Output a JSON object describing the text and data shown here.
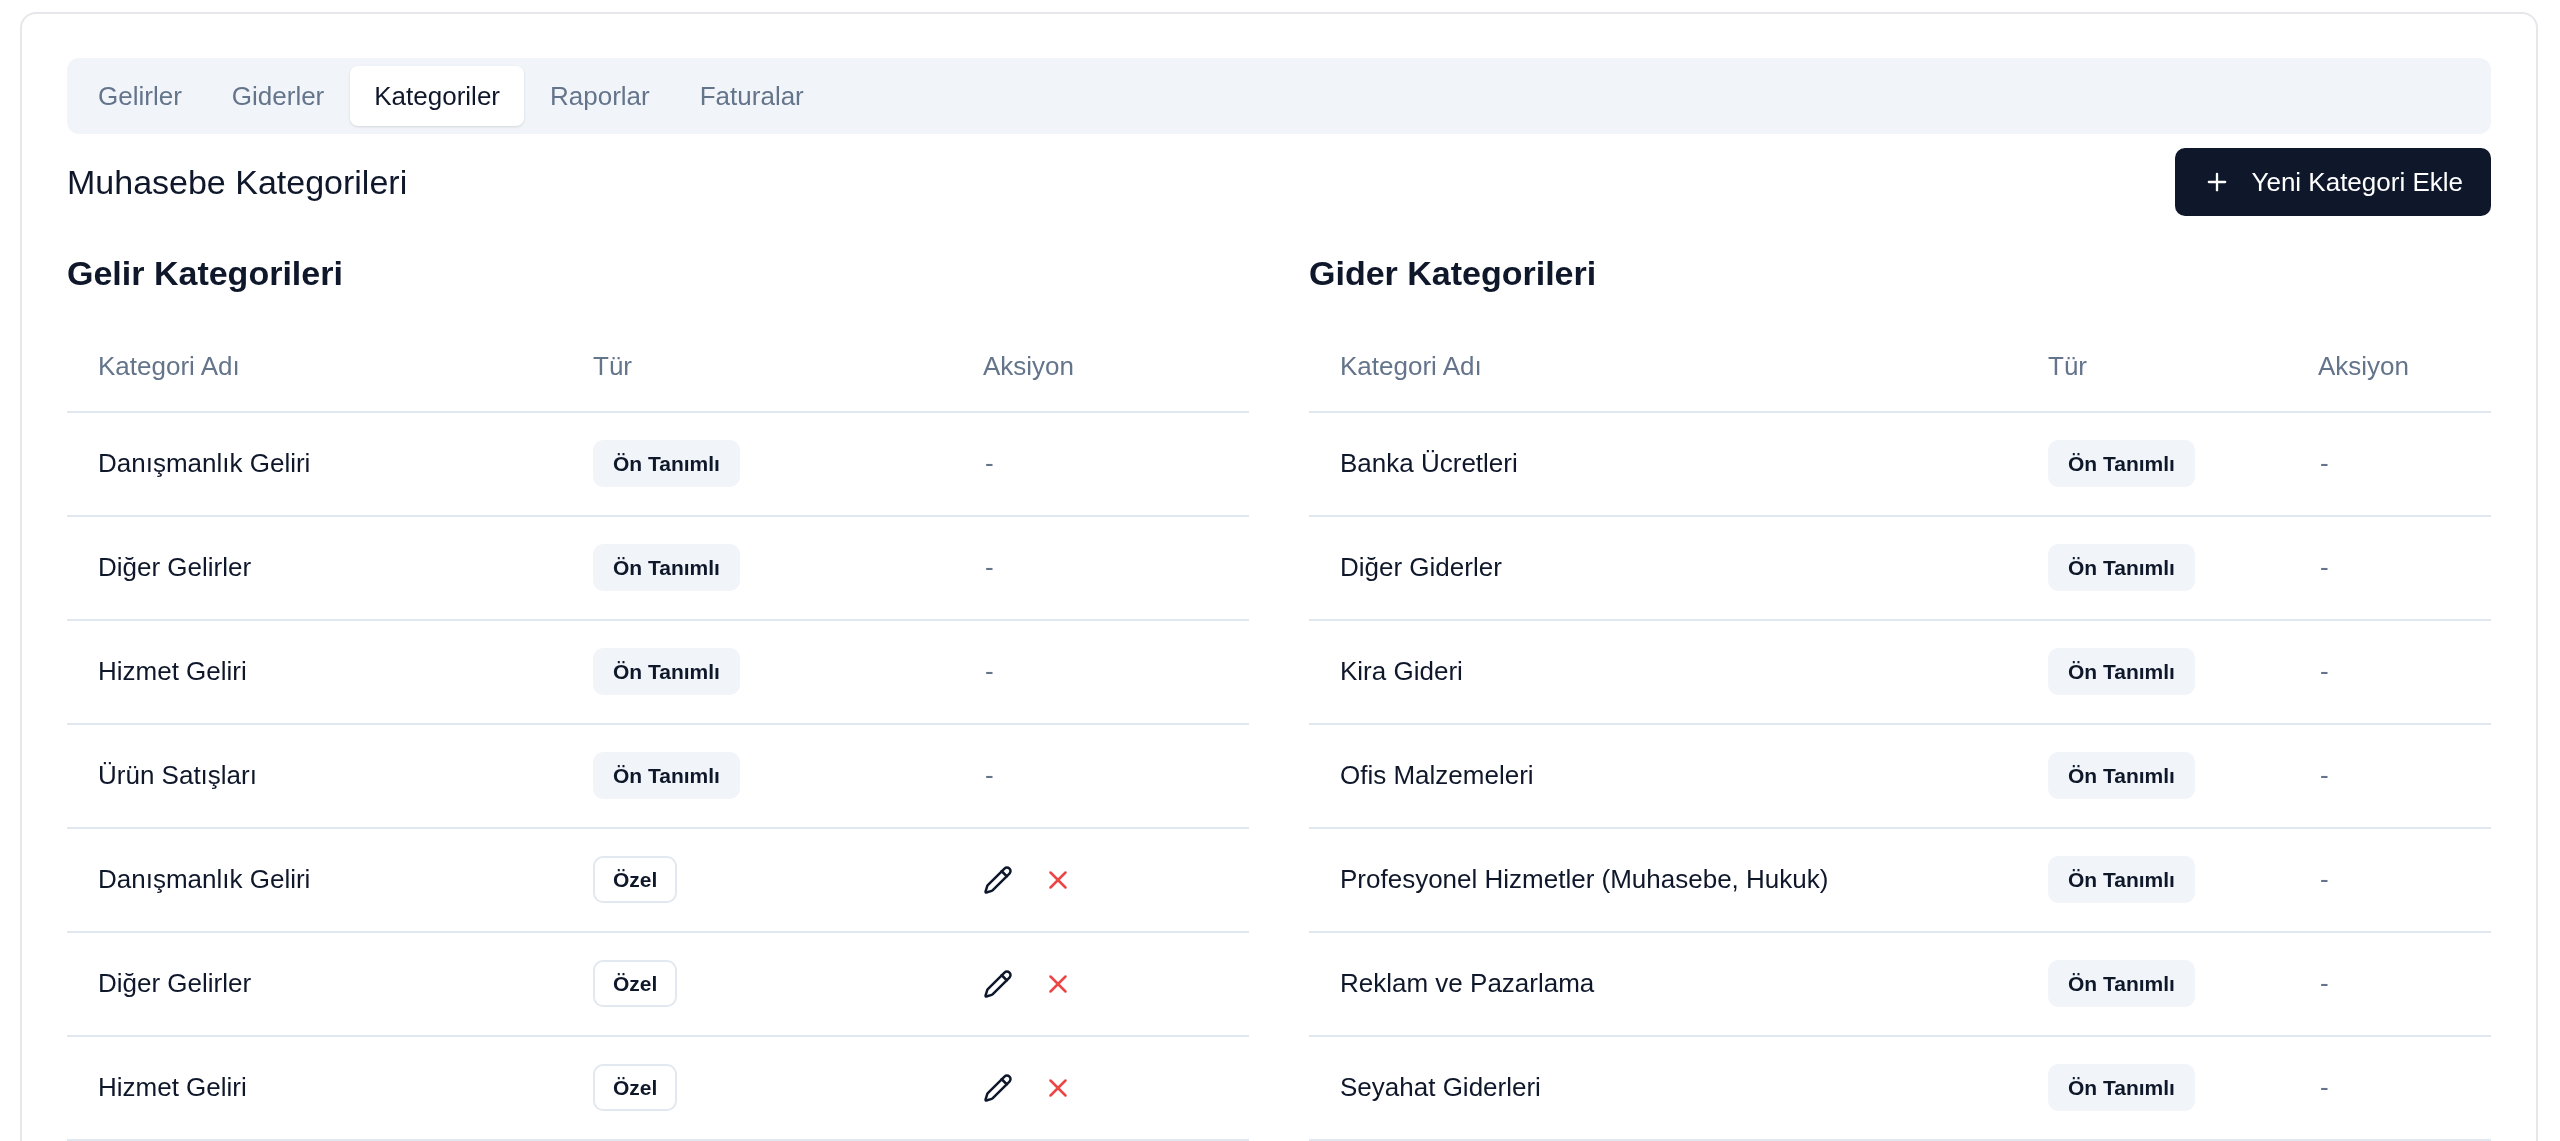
{
  "tabs": [
    {
      "label": "Gelirler",
      "selected": false
    },
    {
      "label": "Giderler",
      "selected": false
    },
    {
      "label": "Kategoriler",
      "selected": true
    },
    {
      "label": "Raporlar",
      "selected": false
    },
    {
      "label": "Faturalar",
      "selected": false
    }
  ],
  "page_title": "Muhasebe Kategorileri",
  "add_button": {
    "label": "Yeni Kategori Ekle"
  },
  "tables": [
    {
      "title": "Gelir Kategorileri",
      "columns": [
        "Kategori Adı",
        "Tür",
        "Aksiyon"
      ],
      "rows": [
        {
          "name": "Danışmanlık Geliri",
          "kind": "predefined",
          "type": "Ön Tanımlı",
          "action": "-"
        },
        {
          "name": "Diğer Gelirler",
          "kind": "predefined",
          "type": "Ön Tanımlı",
          "action": "-"
        },
        {
          "name": "Hizmet Geliri",
          "kind": "predefined",
          "type": "Ön Tanımlı",
          "action": "-"
        },
        {
          "name": "Ürün Satışları",
          "kind": "predefined",
          "type": "Ön Tanımlı",
          "action": "-"
        },
        {
          "name": "Danışmanlık Geliri",
          "kind": "custom",
          "type": "Özel"
        },
        {
          "name": "Diğer Gelirler",
          "kind": "custom",
          "type": "Özel"
        },
        {
          "name": "Hizmet Geliri",
          "kind": "custom",
          "type": "Özel"
        }
      ]
    },
    {
      "title": "Gider Kategorileri",
      "columns": [
        "Kategori Adı",
        "Tür",
        "Aksiyon"
      ],
      "rows": [
        {
          "name": "Banka Ücretleri",
          "kind": "predefined",
          "type": "Ön Tanımlı",
          "action": "-"
        },
        {
          "name": "Diğer Giderler",
          "kind": "predefined",
          "type": "Ön Tanımlı",
          "action": "-"
        },
        {
          "name": "Kira Gideri",
          "kind": "predefined",
          "type": "Ön Tanımlı",
          "action": "-"
        },
        {
          "name": "Ofis Malzemeleri",
          "kind": "predefined",
          "type": "Ön Tanımlı",
          "action": "-"
        },
        {
          "name": "Profesyonel Hizmetler (Muhasebe, Hukuk)",
          "kind": "predefined",
          "type": "Ön Tanımlı",
          "action": "-"
        },
        {
          "name": "Reklam ve Pazarlama",
          "kind": "predefined",
          "type": "Ön Tanımlı",
          "action": "-"
        },
        {
          "name": "Seyahat Giderleri",
          "kind": "predefined",
          "type": "Ön Tanımlı",
          "action": "-"
        }
      ]
    }
  ]
}
